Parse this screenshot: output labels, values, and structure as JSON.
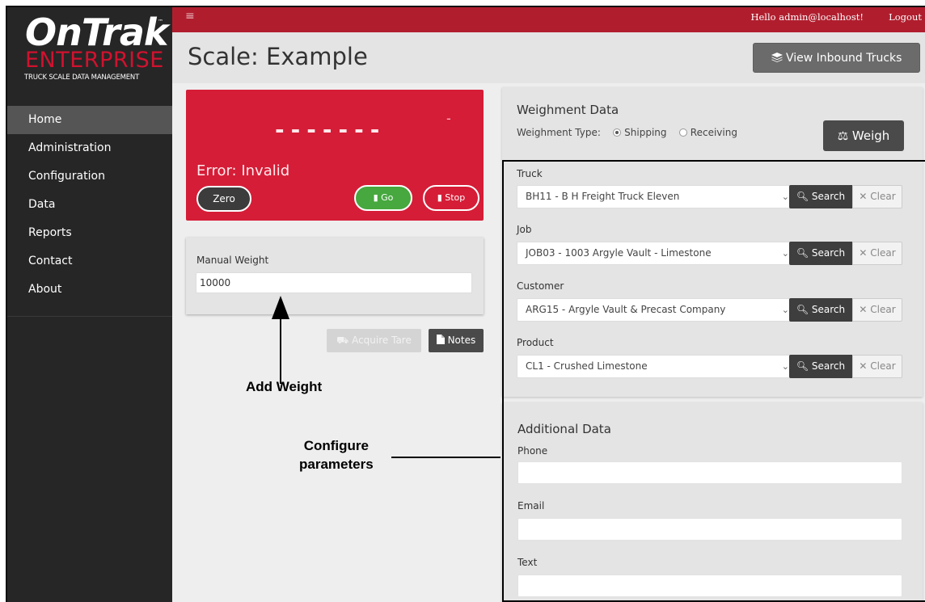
{
  "logo": {
    "main": "OnTrak",
    "tm": "™",
    "sub": "ENTERPRISE",
    "tagline": "TRUCK SCALE DATA MANAGEMENT"
  },
  "nav": {
    "items": [
      {
        "label": "Home"
      },
      {
        "label": "Administration"
      },
      {
        "label": "Configuration"
      },
      {
        "label": "Data"
      },
      {
        "label": "Reports"
      },
      {
        "label": "Contact"
      },
      {
        "label": "About"
      }
    ]
  },
  "topbar": {
    "menu_icon": "≡",
    "hello": "Hello admin@localhost!",
    "logout": "Logout"
  },
  "header": {
    "title": "Scale: Example",
    "inbound_button": "View Inbound Trucks"
  },
  "scale": {
    "small_dash": "-",
    "display": "-------",
    "error": "Error: Invalid",
    "zero": "Zero",
    "go": "Go",
    "stop": "Stop"
  },
  "manual": {
    "label": "Manual Weight",
    "value": "10000"
  },
  "actions": {
    "acquire_tare": "Acquire Tare",
    "notes": "Notes"
  },
  "annotations": {
    "add_weight": "Add Weight",
    "configure_line1": "Configure",
    "configure_line2": "parameters"
  },
  "weighment": {
    "title": "Weighment Data",
    "type_label": "Weighment Type:",
    "option_shipping": "Shipping",
    "option_receiving": "Receiving",
    "selected": "Shipping",
    "weigh_button": "Weigh",
    "search_label": "Search",
    "clear_label": "Clear",
    "fields": [
      {
        "label": "Truck",
        "value": "BH11 - B H Freight Truck Eleven"
      },
      {
        "label": "Job",
        "value": "JOB03 - 1003 Argyle Vault - Limestone"
      },
      {
        "label": "Customer",
        "value": "ARG15 - Argyle Vault & Precast Company"
      },
      {
        "label": "Product",
        "value": "CL1 - Crushed Limestone"
      }
    ]
  },
  "additional": {
    "title": "Additional Data",
    "fields": [
      {
        "label": "Phone",
        "value": ""
      },
      {
        "label": "Email",
        "value": ""
      },
      {
        "label": "Text",
        "value": ""
      }
    ]
  },
  "colors": {
    "brand_red": "#d51d37",
    "topbar_red": "#b01e2e",
    "sidebar": "#262626",
    "go_green": "#46a83e"
  }
}
